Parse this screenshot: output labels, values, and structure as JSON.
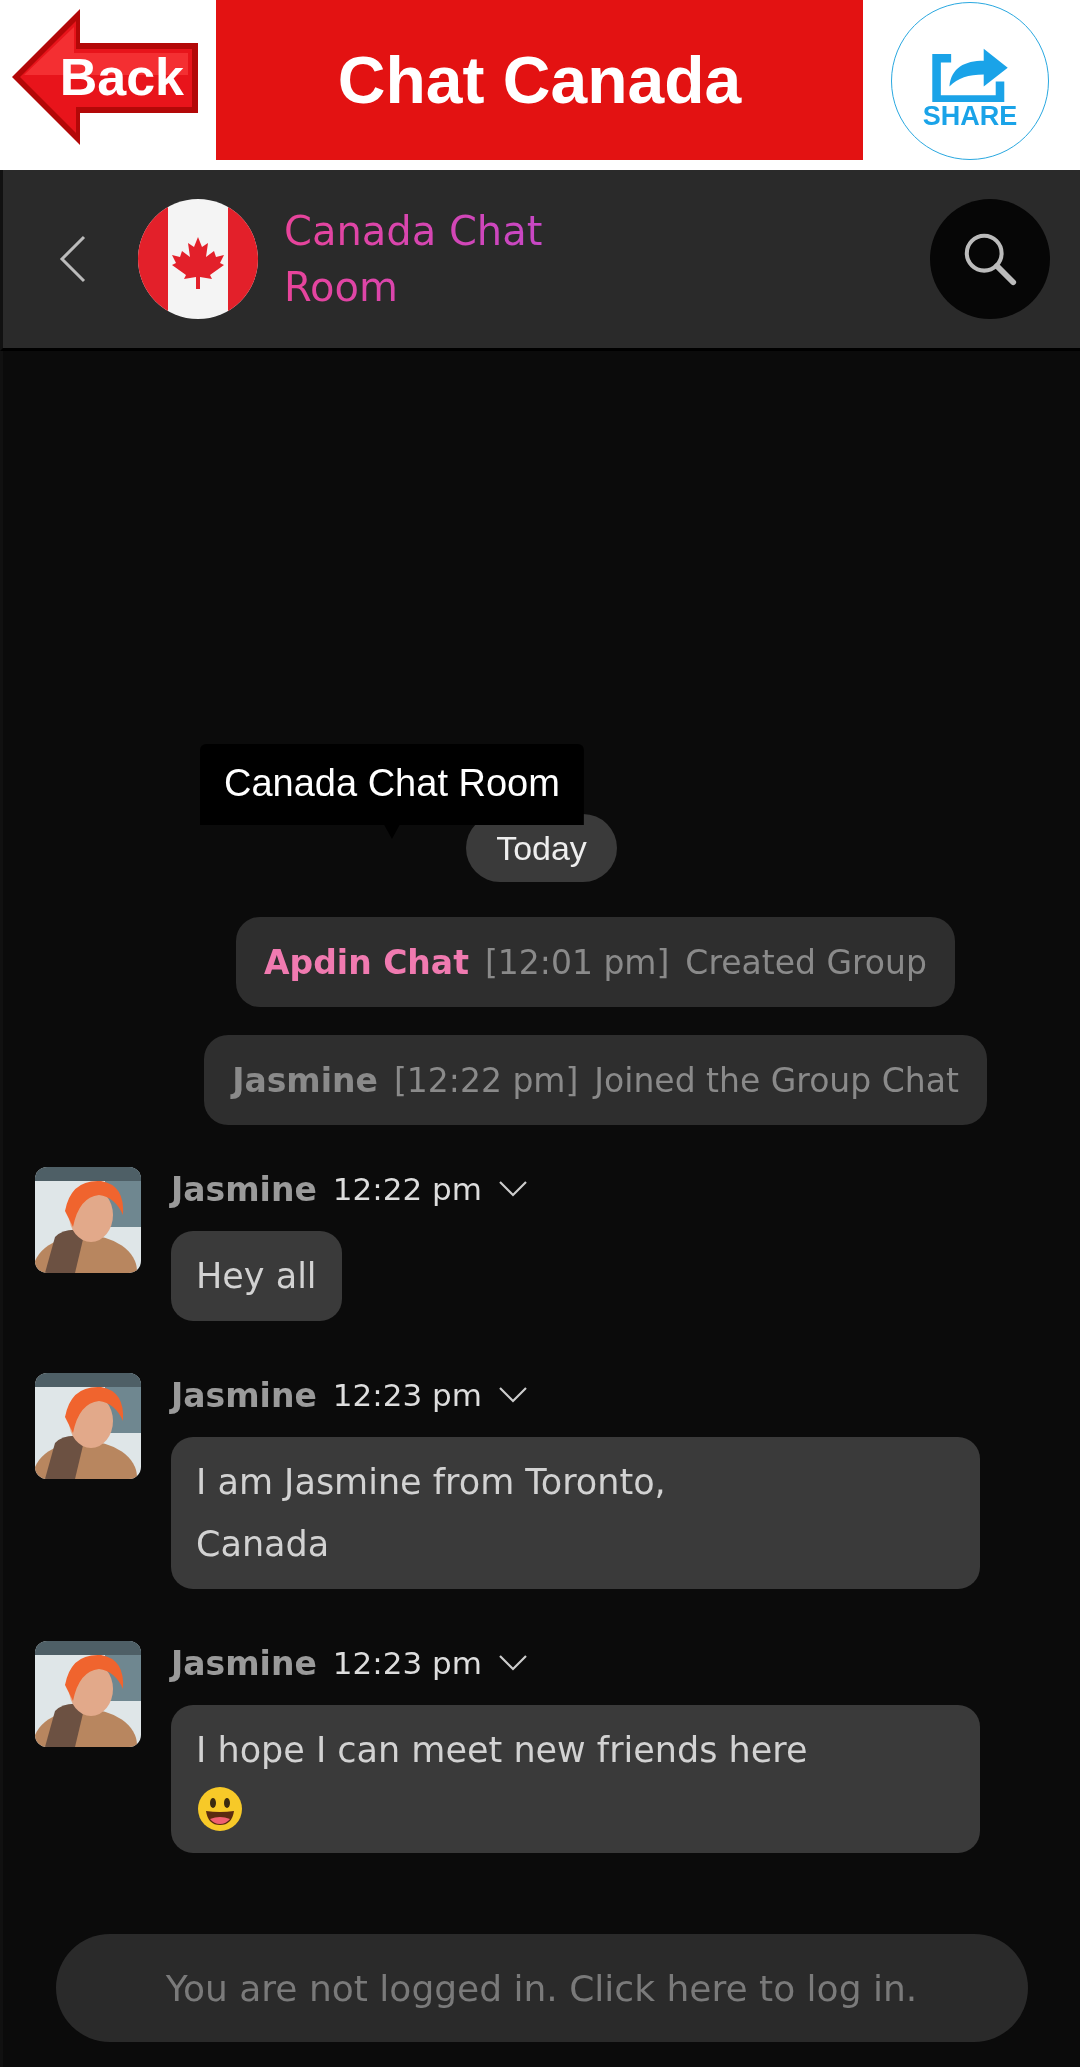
{
  "top_bar": {
    "back_label": "Back",
    "title": "Chat Canada",
    "share_label": "SHARE"
  },
  "header": {
    "title": "Canada Chat Room"
  },
  "tooltip": "Canada Chat Room",
  "date_chip": "Today",
  "events": [
    {
      "kind": "admin",
      "actor": "Apdin Chat",
      "time": "[12:01 pm]",
      "action": "Created Group"
    },
    {
      "kind": "member",
      "actor": "Jasmine",
      "time": "[12:22 pm]",
      "action": "Joined the Group Chat"
    }
  ],
  "messages": [
    {
      "sender": "Jasmine",
      "time": "12:22 pm",
      "text": "Hey all",
      "emoji": false
    },
    {
      "sender": "Jasmine",
      "time": "12:23 pm",
      "text": "I am Jasmine from Toronto,\nCanada",
      "emoji": false
    },
    {
      "sender": "Jasmine",
      "time": "12:23 pm",
      "text": "I hope I can meet new friends here",
      "emoji": true
    }
  ],
  "login_prompt": "You are not logged in. Click here to log in."
}
